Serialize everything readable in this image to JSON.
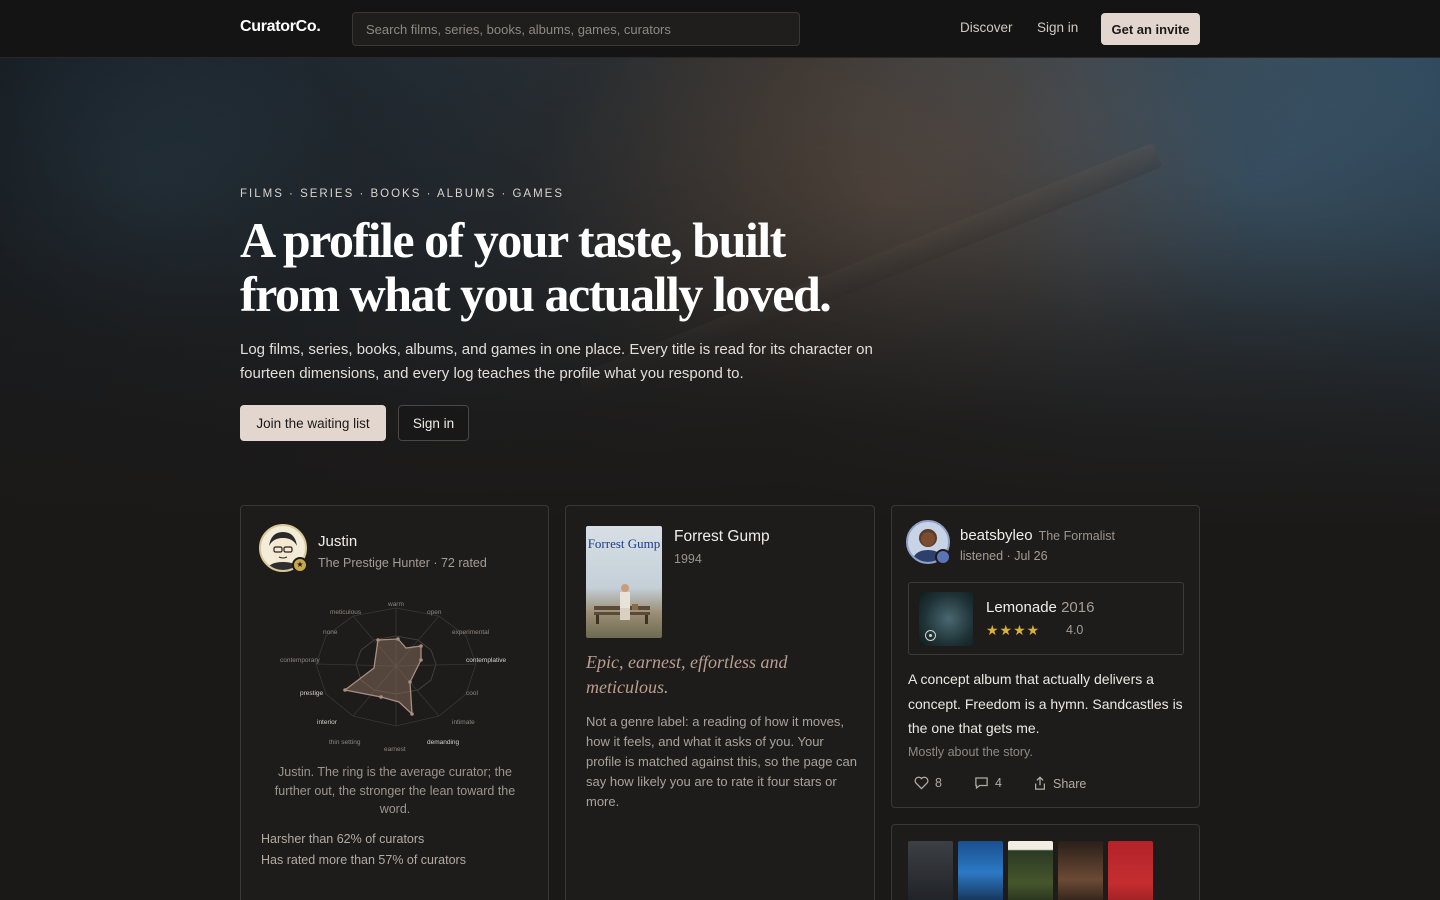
{
  "header": {
    "logo": "CuratorCo.",
    "search_placeholder": "Search films, series, books, albums, games, curators",
    "discover": "Discover",
    "sign_in": "Sign in",
    "get_invite": "Get an invite"
  },
  "hero": {
    "kicker": "FILMS · SERIES · BOOKS · ALBUMS · GAMES",
    "headline": "A profile of your taste, built from what you actually loved.",
    "subtitle": "Log films, series, books, albums, and games in one place. Every title is read for its character on fourteen dimensions, and every log teaches the profile what you respond to.",
    "primary_cta": "Join the waiting list",
    "secondary_cta": "Sign in"
  },
  "profile_card": {
    "name": "Justin",
    "meta": "The Prestige Hunter · 72 rated",
    "radar_labels": {
      "warm": "warm",
      "open": "open",
      "experimental": "experimental",
      "contemplative": "contemplative",
      "cool": "cool",
      "intimate": "intimate",
      "demanding": "demanding",
      "earnest": "earnest",
      "thin_setting": "thin setting",
      "interior": "interior",
      "prestige": "prestige",
      "contemporary": "contemporary",
      "none": "none",
      "meticulous": "meticulous"
    },
    "caption": "Justin. The ring is the average curator; the further out, the stronger the lean toward the word.",
    "stat_1": "Harsher than 62% of curators",
    "stat_2": "Has rated more than 57% of curators"
  },
  "film_card": {
    "poster_title": "Forrest Gump",
    "title": "Forrest Gump",
    "year": "1994",
    "tagline": "Epic, earnest, effortless and meticulous.",
    "blurb": "Not a genre label: a reading of how it moves, how it feels, and what it asks of you. Your profile is matched against this, so the page can say how likely you are to rate it four stars or more."
  },
  "activity_card": {
    "user": "beatsbyleo",
    "role": "The Formalist",
    "meta": "listened · Jul 26",
    "album_title": "Lemonade",
    "album_year": "2016",
    "stars": "★★★★",
    "rating": "4.0",
    "review": "A concept album that actually delivers a concept. Freedom is a hymn. Sandcastles is the one that gets me.",
    "note": "Mostly about the story.",
    "likes": "8",
    "comments": "4",
    "share": "Share"
  },
  "colors": {
    "accent": "#e3d6ce",
    "background": "#1b1918",
    "star": "#d8b13a",
    "tagline": "#b89f90"
  }
}
